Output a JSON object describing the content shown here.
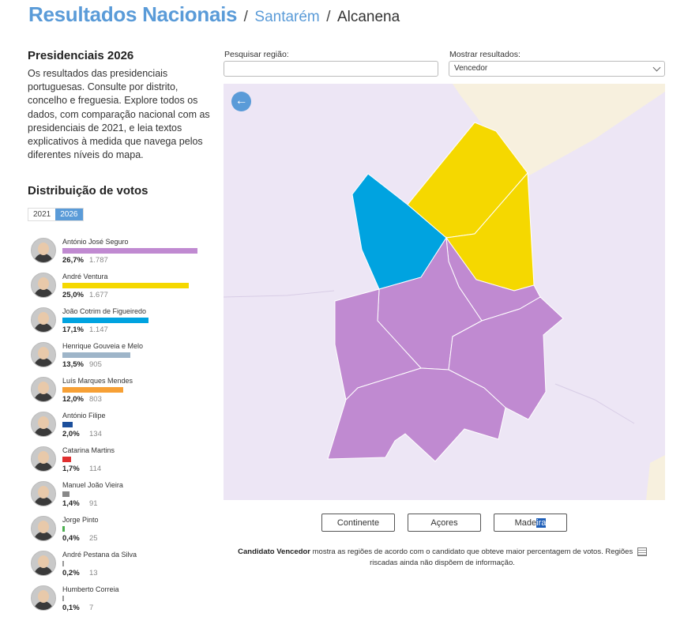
{
  "header": {
    "title": "Resultados Nacionais",
    "sep1": "/",
    "crumb1": "Santarém",
    "sep2": "/",
    "current": "Alcanena"
  },
  "intro": {
    "title": "Presidenciais 2026",
    "text": "Os resultados das presidenciais portuguesas. Consulte por distrito, concelho e freguesia. Explore todos os dados, com comparação nacional com as presidenciais de 2021, e leia textos explicativos à medida que navega pelos diferentes níveis do mapa."
  },
  "distribution": {
    "title": "Distribuição de votos",
    "years": [
      "2021",
      "2026"
    ],
    "active_year": "2026"
  },
  "candidates": [
    {
      "name": "António José Seguro",
      "pct": "26,7%",
      "votes": "1.787",
      "share": 0.267,
      "color": "#c08ad1"
    },
    {
      "name": "André Ventura",
      "pct": "25,0%",
      "votes": "1.677",
      "share": 0.25,
      "color": "#f5d800"
    },
    {
      "name": "João Cotrim de Figueiredo",
      "pct": "17,1%",
      "votes": "1.147",
      "share": 0.171,
      "color": "#00a3e0"
    },
    {
      "name": "Henrique Gouveia e Melo",
      "pct": "13,5%",
      "votes": "905",
      "share": 0.135,
      "color": "#9eb5c9"
    },
    {
      "name": "Luís Marques Mendes",
      "pct": "12,0%",
      "votes": "803",
      "share": 0.12,
      "color": "#f7a035"
    },
    {
      "name": "António Filipe",
      "pct": "2,0%",
      "votes": "134",
      "share": 0.02,
      "color": "#1c4f9c"
    },
    {
      "name": "Catarina Martins",
      "pct": "1,7%",
      "votes": "114",
      "share": 0.017,
      "color": "#e03030"
    },
    {
      "name": "Manuel João Vieira",
      "pct": "1,4%",
      "votes": "91",
      "share": 0.014,
      "color": "#888888"
    },
    {
      "name": "Jorge Pinto",
      "pct": "0,4%",
      "votes": "25",
      "share": 0.004,
      "color": "#4caf50"
    },
    {
      "name": "André Pestana da Silva",
      "pct": "0,2%",
      "votes": "13",
      "share": 0.002,
      "color": "#999999"
    },
    {
      "name": "Humberto Correia",
      "pct": "0,1%",
      "votes": "7",
      "share": 0.001,
      "color": "#999999"
    }
  ],
  "controls": {
    "search_label": "Pesquisar região:",
    "search_value": "",
    "search_placeholder": "",
    "results_label": "Mostrar resultados:",
    "results_value": "Vencedor"
  },
  "map": {
    "back_icon": "arrow-left-icon",
    "colors": {
      "winner_seguro": "#c08ad1",
      "winner_ventura": "#f5d800",
      "winner_cotrim": "#00a3e0",
      "background": "#ede6f5",
      "land_out": "#f7f0de"
    }
  },
  "region_buttons": {
    "continente": "Continente",
    "acores": "Açores",
    "madeira_a": "Made",
    "madeira_b": "ira"
  },
  "footnote": {
    "bold": "Candidato Vencedor",
    "text": " mostra as regiões de acordo com o candidato que obteve maior percentagem de votos. Regiões",
    "text2": "riscadas ainda não dispõem de informação."
  }
}
